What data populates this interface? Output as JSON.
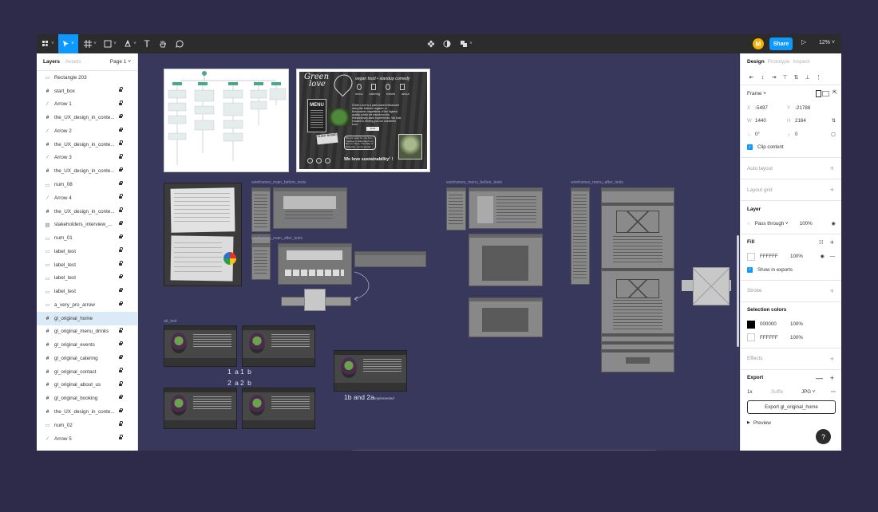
{
  "toolbar": {
    "share_label": "Share",
    "zoom": "12%",
    "avatar_initial": "M"
  },
  "left_panel": {
    "tab_layers": "Layers",
    "tab_assets": "Assets",
    "page": "Page 1 ˅",
    "layers": [
      {
        "name": "Rectangle 203",
        "icon": "rect",
        "locked": false,
        "selected": false
      },
      {
        "name": "start_box",
        "icon": "frame",
        "locked": true,
        "selected": false
      },
      {
        "name": "Arrow 1",
        "icon": "line",
        "locked": true,
        "selected": false
      },
      {
        "name": "the_UX_design_in_conte...",
        "icon": "frame",
        "locked": true,
        "selected": false
      },
      {
        "name": "Arrow 2",
        "icon": "line",
        "locked": true,
        "selected": false
      },
      {
        "name": "the_UX_design_in_conte...",
        "icon": "frame",
        "locked": true,
        "selected": false
      },
      {
        "name": "Arrow 3",
        "icon": "line",
        "locked": true,
        "selected": false
      },
      {
        "name": "the_UX_design_in_conte...",
        "icon": "frame",
        "locked": true,
        "selected": false
      },
      {
        "name": "num_08",
        "icon": "rect",
        "locked": true,
        "selected": false
      },
      {
        "name": "Arrow 4",
        "icon": "line",
        "locked": true,
        "selected": false
      },
      {
        "name": "the_UX_design_in_conte...",
        "icon": "frame",
        "locked": true,
        "selected": false
      },
      {
        "name": "stakeholders_interview_...",
        "icon": "image",
        "locked": true,
        "selected": false
      },
      {
        "name": "num_01",
        "icon": "rect",
        "locked": true,
        "selected": false
      },
      {
        "name": "label_test",
        "icon": "rect",
        "locked": true,
        "selected": false
      },
      {
        "name": "label_test",
        "icon": "rect",
        "locked": true,
        "selected": false
      },
      {
        "name": "label_test",
        "icon": "rect",
        "locked": true,
        "selected": false
      },
      {
        "name": "label_test",
        "icon": "rect",
        "locked": true,
        "selected": false
      },
      {
        "name": "a_very_pro_arrow",
        "icon": "rect",
        "locked": true,
        "selected": false
      },
      {
        "name": "gl_original_home",
        "icon": "frame",
        "locked": false,
        "selected": true
      },
      {
        "name": "gl_original_menu_drinks",
        "icon": "frame",
        "locked": true,
        "selected": false
      },
      {
        "name": "gl_original_events",
        "icon": "frame",
        "locked": true,
        "selected": false
      },
      {
        "name": "gl_original_catering",
        "icon": "frame",
        "locked": true,
        "selected": false
      },
      {
        "name": "gl_original_contact",
        "icon": "frame",
        "locked": true,
        "selected": false
      },
      {
        "name": "gl_original_about_us",
        "icon": "frame",
        "locked": true,
        "selected": false
      },
      {
        "name": "gl_original_booking",
        "icon": "frame",
        "locked": true,
        "selected": false
      },
      {
        "name": "the_UX_design_in_conte...",
        "icon": "frame",
        "locked": true,
        "selected": false
      },
      {
        "name": "num_02",
        "icon": "rect",
        "locked": true,
        "selected": false
      },
      {
        "name": "Arrow 5",
        "icon": "line",
        "locked": true,
        "selected": false
      }
    ]
  },
  "right_panel": {
    "tab_design": "Design",
    "tab_prototype": "Prototype",
    "tab_inspect": "Inspect",
    "frame_label": "Frame ˅",
    "x_label": "X",
    "x": "-5497",
    "y_label": "Y",
    "y": "-21788",
    "w_label": "W",
    "w": "1440",
    "h_label": "H",
    "h": "2164",
    "rot_label": "∟",
    "rotation": "0°",
    "rad_label": "╭",
    "radius": "0",
    "clip_content": "Clip content",
    "auto_layout": "Auto layout",
    "layout_grid": "Layout grid",
    "layer_title": "Layer",
    "blend": "Pass through ˅",
    "layer_opacity": "100%",
    "fill_title": "Fill",
    "fill_hex": "FFFFFF",
    "fill_opacity": "100%",
    "show_in_exports": "Show in exports",
    "stroke_title": "Stroke",
    "selection_colors_title": "Selection colors",
    "sel_colors": [
      {
        "hex": "000000",
        "opacity": "100%",
        "swatch": "#000000"
      },
      {
        "hex": "FFFFFF",
        "opacity": "100%",
        "swatch": "#ffffff"
      }
    ],
    "effects_title": "Effects",
    "export_title": "Export",
    "export_scale": "1x",
    "export_suffix": "Suffix",
    "export_format": "JPG ˅",
    "export_button": "Export gl_original_home",
    "preview": "Preview",
    "help": "?"
  },
  "canvas": {
    "labels": {
      "main_before": "wireframes_main_before_tests",
      "main_after": "wireframes_main_after_tests",
      "menu_before": "wireframes_menu_before_tests",
      "menu_after": "wireframes_menu_after_tests",
      "ab_test": "ab_test"
    },
    "ab_labels": {
      "l1a": "1 a",
      "l1b": "1 b",
      "l2a": "2 a",
      "l2b": "2 b",
      "combo": "1b and 2a",
      "combo_sub": "implemented"
    },
    "moodboard": {
      "brand_line1": "Green",
      "brand_line2": "love",
      "tagline": "vegan food • standup comedy",
      "nav": [
        "menu",
        "catering",
        "events",
        "about"
      ],
      "menu_sign": "MENU",
      "plant_sign": "PLANT BASED",
      "intro": "Green Love is a plant-based restaurant using the freshest organic¹ or biodynamic² vegetables of the highest quality, which we transform into extraordinary taste experiences. We look forward to serving you our wonderful food.",
      "book": "book",
      "hours": "We are open for you from Tuesday to Saturday from 5pm to 11pm. Thursday & Saturday - funny people",
      "sustain": "We love sustainability¹ !"
    }
  }
}
